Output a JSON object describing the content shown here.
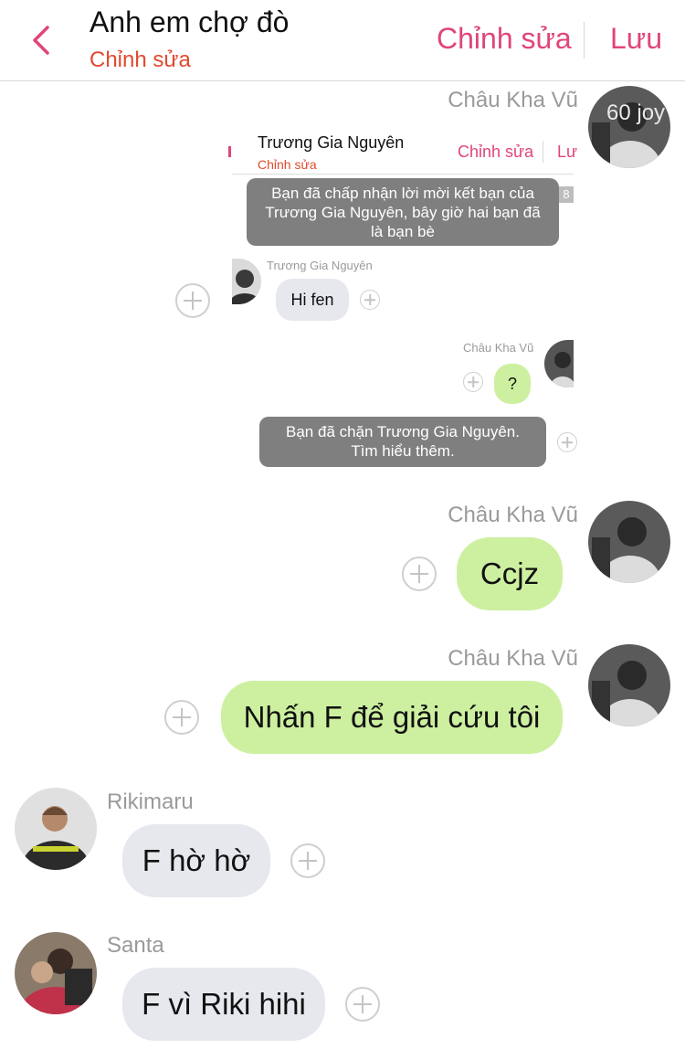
{
  "header": {
    "title": "Anh em chợ đò",
    "subtitle": "Chỉnh sửa",
    "edit_label": "Chỉnh sửa",
    "save_label": "Lưu"
  },
  "colors": {
    "accent": "#e0457b",
    "subtitle": "#e04a2e",
    "outgoing_bubble": "#cdf0a0",
    "incoming_bubble": "#e6e8ed",
    "system_message": "#7f7f7f"
  },
  "messages": [
    {
      "sender": "Châu Kha Vũ",
      "direction": "outgoing",
      "type": "image",
      "avatar_overlay": "60 joy",
      "embedded": {
        "title": "Trương Gia Nguyên",
        "subtitle": "Chỉnh sửa",
        "edit_label": "Chỉnh sửa",
        "save_label": "Lư",
        "badge": "8",
        "system_1": "Bạn đã chấp nhận lời mời kết bạn của Trương Gia Nguyên, bây giờ hai bạn đã là bạn bè",
        "msg_1_sender": "Trương Gia Nguyên",
        "msg_1_text": "Hi fen",
        "msg_2_sender": "Châu Kha Vũ",
        "msg_2_text": "?",
        "system_2": "Bạn đã chặn Trương Gia Nguyên. Tìm hiểu thêm."
      }
    },
    {
      "sender": "Châu Kha Vũ",
      "direction": "outgoing",
      "text": "Ccjz"
    },
    {
      "sender": "Châu Kha Vũ",
      "direction": "outgoing",
      "text": "Nhấn F để giải cứu tôi"
    },
    {
      "sender": "Rikimaru",
      "direction": "incoming",
      "text": "F hờ hờ"
    },
    {
      "sender": "Santa",
      "direction": "incoming",
      "text": "F vì Riki hihi"
    }
  ]
}
